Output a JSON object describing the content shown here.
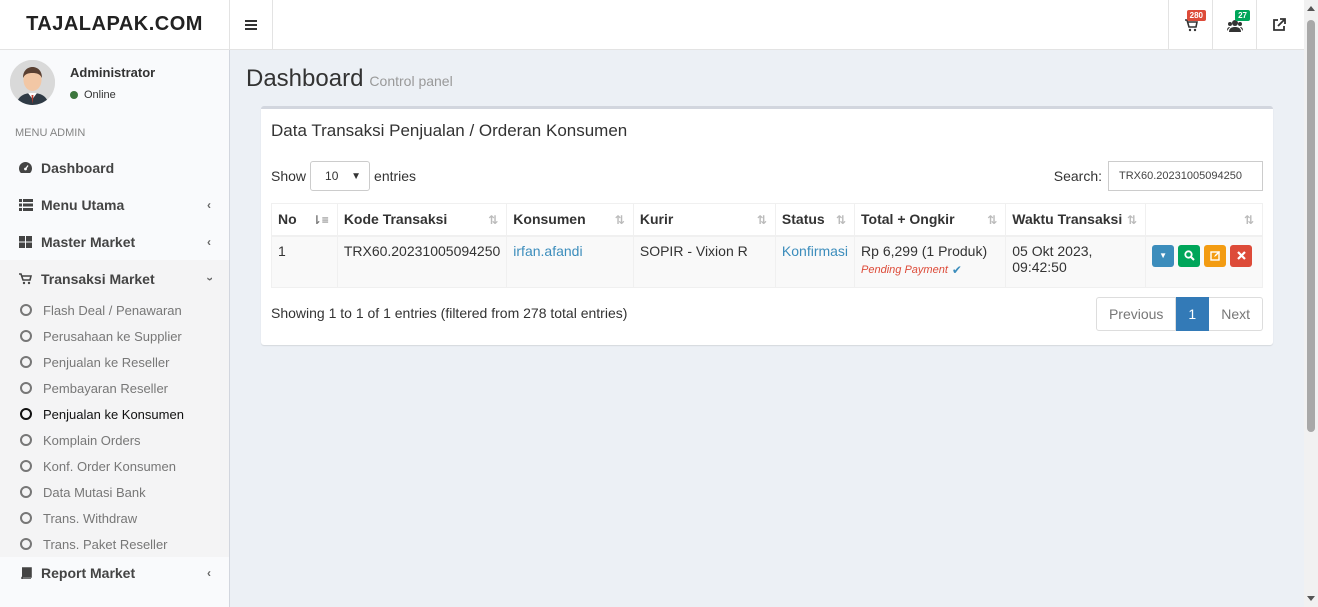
{
  "header": {
    "logo": "TAJALAPAK.COM",
    "cart_badge": "280",
    "users_badge": "27"
  },
  "sidebar": {
    "user_name": "Administrator",
    "user_status": "Online",
    "menu_header": "MENU ADMIN",
    "items": [
      {
        "label": "Dashboard",
        "icon": "dashboard-icon"
      },
      {
        "label": "Menu Utama",
        "icon": "list-icon"
      },
      {
        "label": "Master Market",
        "icon": "grid-icon"
      },
      {
        "label": "Transaksi Market",
        "icon": "cart-icon"
      }
    ],
    "submenu": [
      "Flash Deal / Penawaran",
      "Perusahaan ke Supplier",
      "Penjualan ke Reseller",
      "Pembayaran Reseller",
      "Penjualan ke Konsumen",
      "Komplain Orders",
      "Konf. Order Konsumen",
      "Data Mutasi Bank",
      "Trans. Withdraw",
      "Trans. Paket Reseller"
    ],
    "report": {
      "label": "Report Market",
      "icon": "book-icon"
    }
  },
  "page": {
    "title": "Dashboard",
    "subtitle": "Control panel"
  },
  "box": {
    "title": "Data Transaksi Penjualan / Orderan Konsumen",
    "show_label": "Show",
    "entries_value": "10",
    "entries_label": "entries",
    "search_label": "Search:",
    "search_value": "TRX60.20231005094250",
    "columns": [
      "No",
      "Kode Transaksi",
      "Konsumen",
      "Kurir",
      "Status",
      "Total + Ongkir",
      "Waktu Transaksi",
      ""
    ],
    "rows": [
      {
        "no": "1",
        "kode": "TRX60.20231005094250",
        "konsumen": "irfan.afandi",
        "kurir": "SOPIR - Vixion R",
        "status": "Konfirmasi",
        "total": "Rp 6,299 (1 Produk)",
        "pending": "Pending Payment",
        "waktu": "05 Okt 2023, 09:42:50"
      }
    ],
    "info": "Showing 1 to 1 of 1 entries (filtered from 278 total entries)",
    "pager": {
      "prev": "Previous",
      "page": "1",
      "next": "Next"
    }
  }
}
